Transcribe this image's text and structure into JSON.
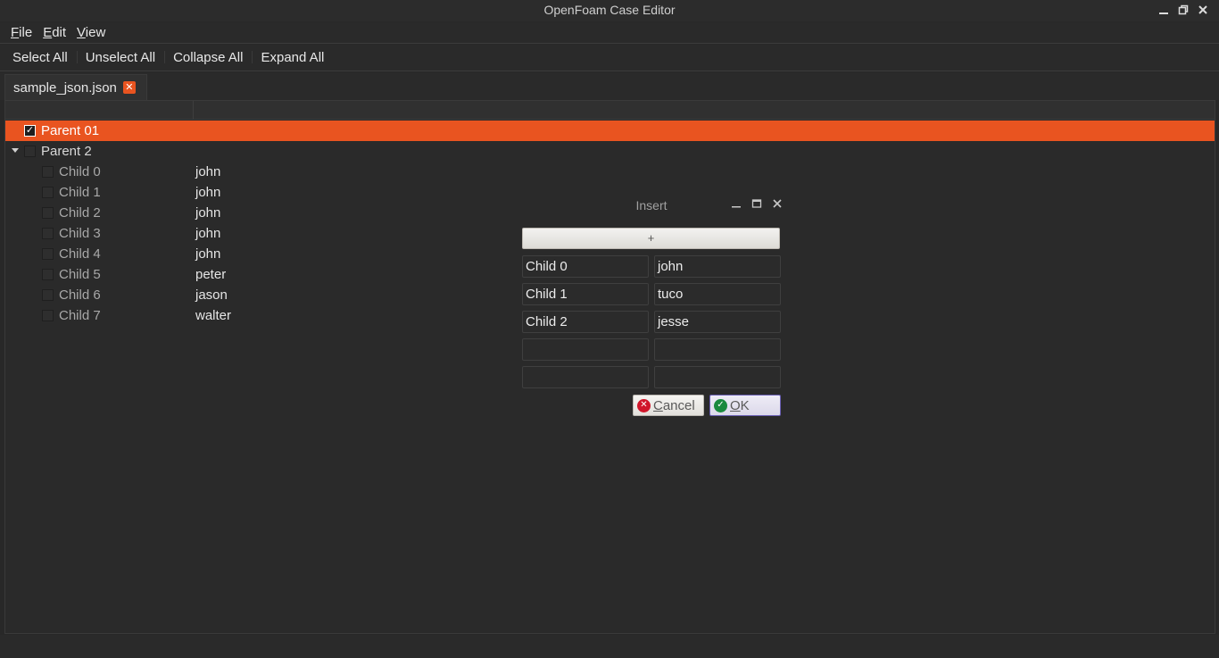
{
  "window": {
    "title": "OpenFoam Case Editor"
  },
  "menu": {
    "file": {
      "first": "F",
      "rest": "ile"
    },
    "edit": {
      "first": "E",
      "rest": "dit"
    },
    "view": {
      "first": "V",
      "rest": "iew"
    }
  },
  "toolbar": {
    "select_all": "Select All",
    "unselect_all": "Unselect All",
    "collapse_all": "Collapse All",
    "expand_all": "Expand All"
  },
  "tab": {
    "label": "sample_json.json",
    "close_icon": "close-icon"
  },
  "tree": {
    "parents": [
      {
        "label": "Parent 01",
        "checked": true,
        "selected": true,
        "expanded": false
      },
      {
        "label": "Parent 2",
        "checked": false,
        "selected": false,
        "expanded": true
      }
    ],
    "children": [
      {
        "label": "Child 0",
        "value": "john"
      },
      {
        "label": "Child 1",
        "value": "john"
      },
      {
        "label": "Child 2",
        "value": "john"
      },
      {
        "label": "Child 3",
        "value": "john"
      },
      {
        "label": "Child 4",
        "value": "john"
      },
      {
        "label": "Child 5",
        "value": "peter"
      },
      {
        "label": "Child 6",
        "value": "jason"
      },
      {
        "label": "Child 7",
        "value": "walter"
      }
    ]
  },
  "dialog": {
    "title": "Insert",
    "add_label": "+",
    "rows": [
      {
        "key": "Child 0",
        "value": "john"
      },
      {
        "key": "Child 1",
        "value": "tuco"
      },
      {
        "key": "Child 2",
        "value": "jesse"
      },
      {
        "key": "",
        "value": ""
      },
      {
        "key": "",
        "value": ""
      }
    ],
    "cancel": {
      "first": "C",
      "rest": "ancel"
    },
    "ok": {
      "first": "O",
      "rest": "K"
    }
  },
  "colors": {
    "accent": "#e95420",
    "background": "#282828"
  }
}
